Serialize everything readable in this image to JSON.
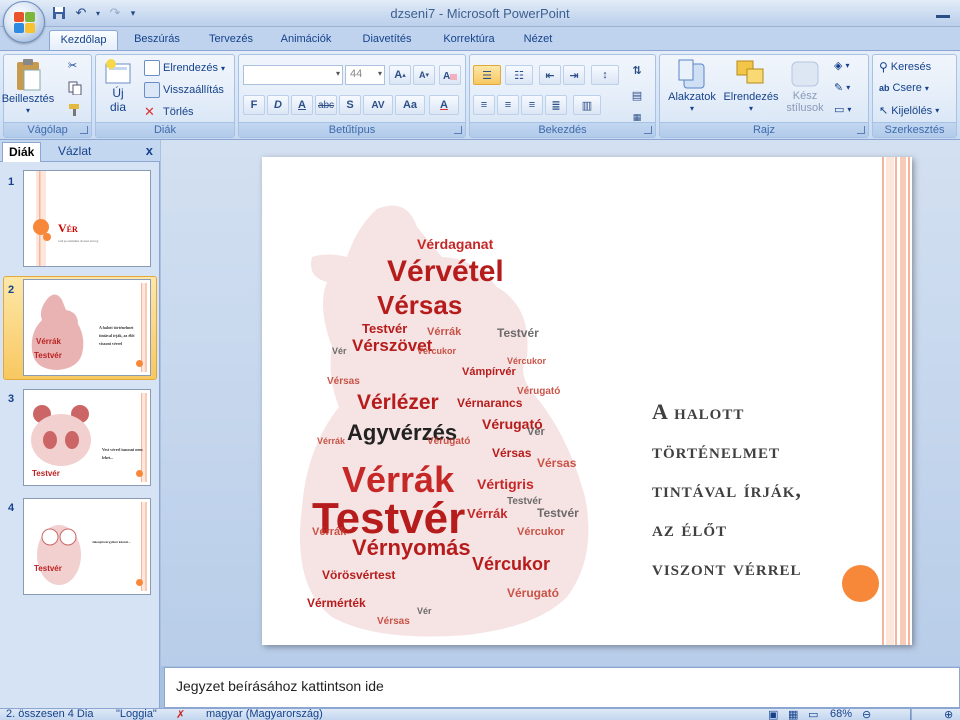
{
  "window": {
    "title": "dzseni7 - Microsoft PowerPoint"
  },
  "ribbon": {
    "tabs": [
      "Kezdőlap",
      "Beszúrás",
      "Tervezés",
      "Animációk",
      "Diavetítés",
      "Korrektúra",
      "Nézet"
    ],
    "active_tab": "Kezdőlap",
    "clipboard": {
      "paste_label": "Beillesztés",
      "group_label": "Vágólap"
    },
    "slides": {
      "new_slide_label": "Új",
      "new_slide_label2": "dia",
      "layout_label": "Elrendezés",
      "reset_label": "Visszaállítás",
      "delete_label": "Törlés",
      "group_label": "Diák"
    },
    "font": {
      "font_name": "",
      "font_size": "44",
      "group_label": "Betűtípus",
      "bold": "F",
      "italic": "D",
      "underline": "A",
      "strike": "abc",
      "shadow": "S",
      "spacing": "AV",
      "case": "Aa",
      "color": "A"
    },
    "paragraph": {
      "group_label": "Bekezdés"
    },
    "drawing": {
      "shapes_label": "Alakzatok",
      "arrange_label": "Elrendezés",
      "quick_styles_label": "Kész",
      "quick_styles_label2": "stílusok",
      "group_label": "Rajz"
    },
    "editing": {
      "find_label": "Keresés",
      "replace_label": "Csere",
      "select_label": "Kijelölés",
      "group_label": "Szerkesztés"
    }
  },
  "slide_pane": {
    "tabs": [
      "Diák",
      "Vázlat"
    ],
    "active_tab": "Diák",
    "close": "x",
    "slides": [
      {
        "number": "1",
        "title": "Vér",
        "subtitle": "vadi pa szisztikus olvasnó szöveg"
      },
      {
        "number": "2",
        "title": "A halott történelmet tintával írják, az élőt viszont vérrel"
      },
      {
        "number": "3",
        "title": "Vest vérrel ismosni nem lehet..."
      },
      {
        "number": "4",
        "title": "Jelenjétvárgyikét között..."
      }
    ],
    "selected_index": 1
  },
  "current_slide": {
    "title_lines": [
      "A halott",
      "történelmet",
      "tintával írják,",
      "az élőt",
      "viszont vérrel"
    ],
    "word_cloud": [
      "Vérvétel",
      "Vérsas",
      "Vérrák",
      "Testvér",
      "Vérszövet",
      "Vérlézer",
      "Agyvérzés",
      "Vérnyomás",
      "Vérdaganat",
      "Vérugató",
      "Vércukor",
      "Vámpírvér",
      "Vérnarancs",
      "Vértigris",
      "Vörösvértest",
      "Vérmérték",
      "Testvér",
      "Vérsas",
      "Vérrák"
    ],
    "accent_color": "#f7883a"
  },
  "notes": {
    "placeholder": "Jegyzet beírásához kattintson ide"
  },
  "statusbar": {
    "slide_info": "2. összesen 4 Dia",
    "theme": "\"Loggia\"",
    "language": "magyar (Magyarország)",
    "zoom": "68%"
  }
}
